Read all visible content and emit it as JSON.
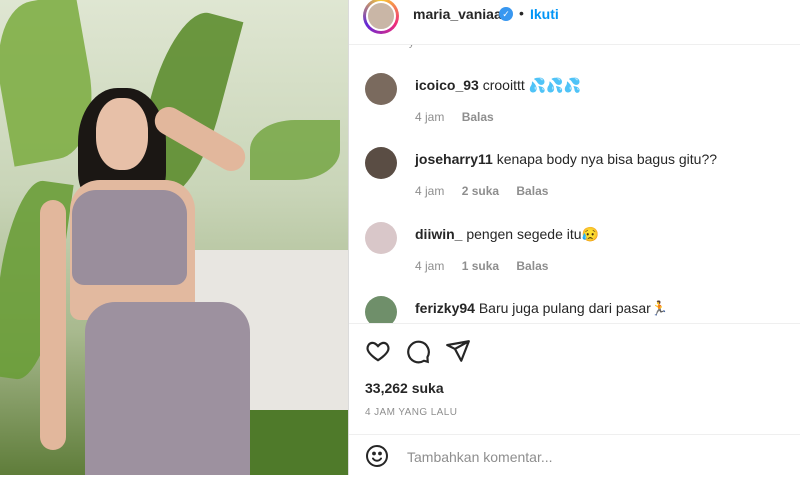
{
  "post": {
    "username": "maria_vaniaa",
    "dot": "•",
    "follow_label": "Ikuti",
    "verified_icon": "verified-badge-icon"
  },
  "comments": [
    {
      "user": "icoico_93",
      "text": "crooittt 💦💦💦",
      "time": "4 jam",
      "likes": "",
      "reply": "Balas"
    },
    {
      "user": "joseharry11",
      "text": "kenapa body nya bisa bagus gitu??",
      "time": "4 jam",
      "likes": "2 suka",
      "reply": "Balas"
    },
    {
      "user": "diiwin_",
      "text": "pengen segede itu😥",
      "time": "4 jam",
      "likes": "1 suka",
      "reply": "Balas"
    },
    {
      "user": "ferizky94",
      "text": "Baru juga pulang dari pasar🏃",
      "time": "",
      "likes": "",
      "reply": ""
    }
  ],
  "actions": {
    "like_icon": "heart-icon",
    "comment_icon": "comment-bubble-icon",
    "share_icon": "paper-plane-icon",
    "likes_count": "33,262 suka",
    "posted_time": "4 JAM YANG LALU"
  },
  "add_comment": {
    "placeholder": "Tambahkan komentar...",
    "emoji_icon": "smiley-icon"
  },
  "colors": {
    "accent": "#0095f6",
    "verified": "#3897f0",
    "muted": "#8e8e8e",
    "text": "#262626"
  }
}
